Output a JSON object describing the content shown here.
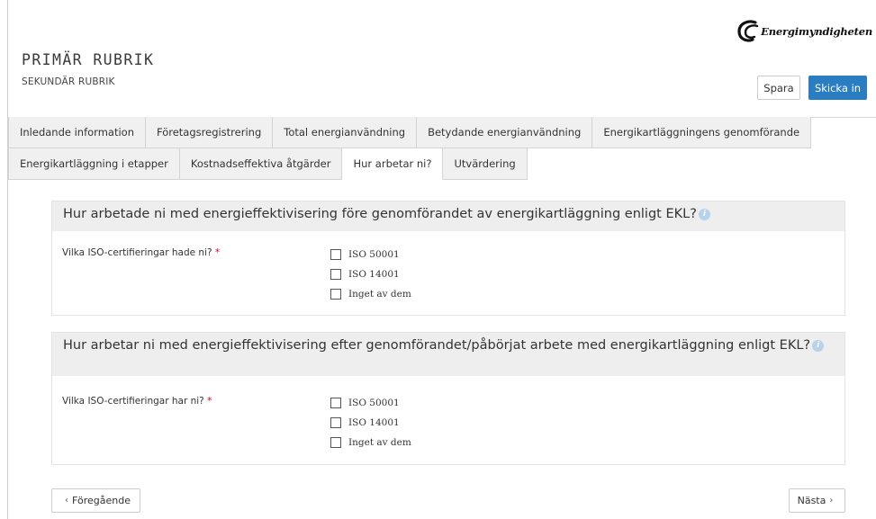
{
  "header": {
    "logo_text": "Energimyndigheten",
    "primary_title": "PRIMÄR RUBRIK",
    "secondary_title": "SEKUNDÄR RUBRIK",
    "save_label": "Spara",
    "submit_label": "Skicka in",
    "submit_color": "#2a7dc0"
  },
  "tabs": {
    "row1": [
      {
        "label": "Inledande information"
      },
      {
        "label": "Företagsregistrering"
      },
      {
        "label": "Total energianvändning"
      },
      {
        "label": "Betydande energianvändning"
      },
      {
        "label": "Energikartläggningens genomförande"
      }
    ],
    "row2": [
      {
        "label": "Energikartläggning i etapper"
      },
      {
        "label": "Kostnadseffektiva åtgärder"
      },
      {
        "label": "Hur arbetar ni?"
      },
      {
        "label": "Utvärdering"
      }
    ],
    "active": "Hur arbetar ni?"
  },
  "sections": [
    {
      "heading": "Hur arbetade ni med energieffektivisering före genomförandet av energikartläggning enligt EKL?",
      "field_label": "Vilka ISO-certifieringar hade ni?",
      "required_mark": "*",
      "options": [
        "ISO 50001",
        "ISO 14001",
        "Inget av dem"
      ]
    },
    {
      "heading": "Hur arbetar ni med energieffektivisering efter genomförandet/påbörjat arbete med energikartläggning enligt EKL?",
      "field_label": "Vilka ISO-certifieringar har ni?",
      "required_mark": "*",
      "options": [
        "ISO 50001",
        "ISO 14001",
        "Inget av dem"
      ]
    }
  ],
  "footer": {
    "prev_label": "Föregående",
    "next_label": "Nästa",
    "prev_chevron": "‹",
    "next_chevron": "›"
  },
  "icons": {
    "info": "info-icon",
    "logo": "energimyndigheten-logo-icon"
  }
}
